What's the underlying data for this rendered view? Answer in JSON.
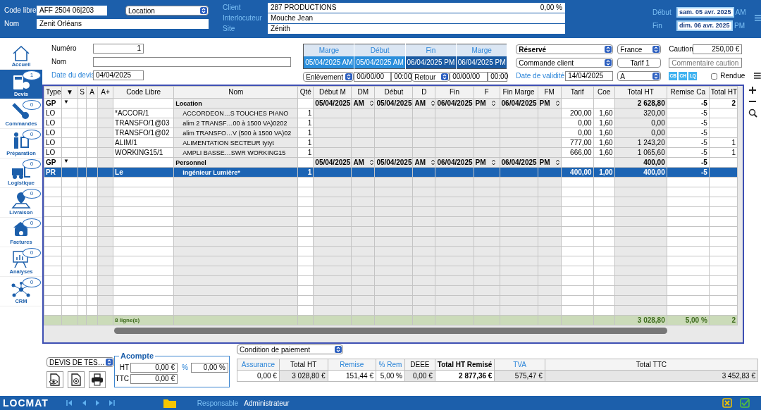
{
  "header": {
    "code_libre": {
      "label": "Code libre",
      "value": "AFF 2504 06|203"
    },
    "type_select": "Location",
    "nom": {
      "label": "Nom",
      "value": "Zenit Orléans"
    },
    "client": {
      "label": "Client",
      "value": "287 PRODUCTIONS",
      "percent": "0,00 %"
    },
    "interlocuteur": {
      "label": "Interlocuteur",
      "value": "Mouche Jean"
    },
    "site": {
      "label": "Site",
      "value": "Zénith"
    },
    "dates": [
      {
        "label": "Début",
        "value": "sam. 05 avr. 2025",
        "period": "AM"
      },
      {
        "label": "Fin",
        "value": "dim. 06 avr. 2025",
        "period": "PM"
      }
    ]
  },
  "sidebar": {
    "items": [
      {
        "label": "Accueil",
        "selected": false
      },
      {
        "label": "Devis",
        "badge": "1",
        "selected": true
      },
      {
        "label": "Commandes",
        "badge": "0",
        "selected": false
      },
      {
        "label": "Préparation",
        "badge": "0",
        "selected": false
      },
      {
        "label": "Logistique",
        "badge": "0",
        "selected": false
      },
      {
        "label": "Livraison",
        "badge": "0",
        "selected": false
      },
      {
        "label": "Factures",
        "badge": "0",
        "selected": false
      },
      {
        "label": "Analyses",
        "badge": "0",
        "selected": false
      },
      {
        "label": "CRM",
        "badge": "0",
        "selected": false
      }
    ]
  },
  "form": {
    "numero": {
      "label": "Numéro",
      "value": "1"
    },
    "nom": {
      "label": "Nom"
    },
    "date_devis": {
      "label": "Date du devis",
      "value": "04/04/2025"
    },
    "margins": {
      "columns": [
        "Marge",
        "Début",
        "Fin",
        "Marge"
      ],
      "values": [
        {
          "text": "05/04/2025 AM",
          "color": "#2b8fdc"
        },
        {
          "text": "05/04/2025 AM",
          "color": "#2b8fdc"
        },
        {
          "text": "06/04/2025 PM",
          "color": "#1a5aa2"
        },
        {
          "text": "06/04/2025 PM",
          "color": "#1a5aa2"
        }
      ]
    },
    "pickup": {
      "type": "Enlèvement",
      "date": "00/00/00",
      "time": "00:00"
    },
    "return": {
      "type": "Retour",
      "date": "00/00/00",
      "time": "00:00"
    },
    "status": "Réservé",
    "order_type": "Commande client",
    "validity": {
      "label": "Date de validité",
      "value": "14/04/2025"
    },
    "country": "France",
    "tariff": "Tarif 1",
    "grade": "A",
    "deposit": {
      "label": "Caution",
      "value": "250,00 €",
      "comment_placeholder": "Commentaire caution"
    },
    "payment_chips": [
      "CB",
      "CH",
      "LQ"
    ],
    "returned": {
      "label": "Rendue",
      "checked": false
    }
  },
  "table": {
    "columns": [
      "Type",
      "▼",
      "S",
      "A",
      "A+",
      "Code Libre",
      "Nom",
      "Qté",
      "Début M",
      "DM",
      "Début",
      "D",
      "Fin",
      "F",
      "Fin Marge",
      "FM",
      "Tarif",
      "Coe",
      "Total HT",
      "Remise Ca",
      "Total HT"
    ],
    "rows": [
      {
        "kind": "group",
        "selected": false,
        "type": "GP",
        "toggle": "▼",
        "nom": "Location",
        "debut_marge": "05/04/2025",
        "dm": "AM",
        "debut": "05/04/2025",
        "d": "AM",
        "fin": "06/04/2025",
        "f": "PM",
        "fin_marge": "06/04/2025",
        "fm": "PM",
        "total_ht": "2 628,80",
        "remise": "-5",
        "total_ht_r": "2"
      },
      {
        "kind": "line",
        "selected": false,
        "type": "LO",
        "code": "*ACCOR/1",
        "nom": "ACCORDEON…S TOUCHES PIANO",
        "qte": "1",
        "tarif": "200,00",
        "coef": "1,60",
        "total_ht": "320,00",
        "remise": "-5"
      },
      {
        "kind": "line",
        "selected": false,
        "type": "LO",
        "code": "TRANSFO/1@03",
        "nom": "alim  2 TRANSF…00 à 1500 VA)0202",
        "qte": "1",
        "tarif": "0,00",
        "coef": "1,60",
        "total_ht": "0,00",
        "remise": "-5"
      },
      {
        "kind": "line",
        "selected": false,
        "type": "LO",
        "code": "TRANSFO/1@02",
        "nom": "alim TRANSFO…V (500 à 1500 VA)02",
        "qte": "1",
        "tarif": "0,00",
        "coef": "1,60",
        "total_ht": "0,00",
        "remise": "-5"
      },
      {
        "kind": "line",
        "selected": false,
        "type": "LO",
        "code": "ALIM/1",
        "nom": "ALIMENTATION SECTEUR tytyt",
        "qte": "1",
        "tarif": "777,00",
        "coef": "1,60",
        "total_ht": "1 243,20",
        "remise": "-5",
        "total_ht_r": "1"
      },
      {
        "kind": "line",
        "selected": false,
        "type": "LO",
        "code": "WORKING15/1",
        "nom": "AMPLI BASSE…SWR WORKING15",
        "qte": "1",
        "tarif": "666,00",
        "coef": "1,60",
        "total_ht": "1 065,60",
        "remise": "-5",
        "total_ht_r": "1"
      },
      {
        "kind": "group",
        "selected": false,
        "type": "GP",
        "toggle": "▼",
        "nom": "Personnel",
        "debut_marge": "05/04/2025",
        "dm": "AM",
        "debut": "05/04/2025",
        "d": "AM",
        "fin": "06/04/2025",
        "f": "PM",
        "fin_marge": "06/04/2025",
        "fm": "PM",
        "total_ht": "400,00",
        "remise": "-5"
      },
      {
        "kind": "line",
        "selected": true,
        "type": "PR",
        "code": "Le",
        "nom": "Ingénieur Lumière*",
        "qte": "1",
        "tarif": "400,00",
        "coef": "1,00",
        "total_ht": "400,00",
        "remise": "-5"
      }
    ],
    "totals": {
      "code": "8 ligne(s)",
      "total_ht": "3 028,80",
      "remise": "5,00 %",
      "total_ht_r": "2"
    }
  },
  "bottom": {
    "document_select": "DEVIS DE TES…",
    "acompte": {
      "title": "Acompte",
      "ht_label": "HT",
      "ht": "0,00 €",
      "percent_label": "%",
      "percent": "0,00 %",
      "ttc_label": "TTC",
      "ttc": "0,00 €"
    },
    "payment_condition": "Condition de paiement",
    "summary": {
      "columns": [
        {
          "label": "Assurance",
          "kind": "link"
        },
        {
          "label": "Total HT",
          "kind": "plain"
        },
        {
          "label": "Remise",
          "kind": "link"
        },
        {
          "label": "% Rem",
          "kind": "link"
        },
        {
          "label": "DEEE",
          "kind": "plain"
        },
        {
          "label": "Total HT Remisé",
          "kind": "bold"
        },
        {
          "label": "TVA",
          "kind": "link"
        },
        {
          "label": "Total TTC",
          "kind": "plain"
        }
      ],
      "values": [
        "0,00 €",
        "3 028,80 €",
        "151,44 €",
        "5,00 %",
        "0,00 €",
        "2 877,36 €",
        "575,47 €",
        "3 452,83 €"
      ]
    }
  },
  "footer": {
    "logo": "LOCMAT",
    "responsible_label": "Responsable",
    "responsible": "Administrateur"
  }
}
